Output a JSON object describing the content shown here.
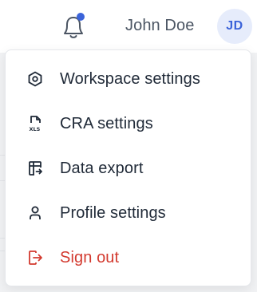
{
  "header": {
    "user_name": "John Doe",
    "avatar_initials": "JD",
    "bell_icon": "bell-icon",
    "notification_color": "#3b63d9"
  },
  "menu": {
    "items": [
      {
        "label": "Workspace settings",
        "icon": "hexagon-settings-icon"
      },
      {
        "label": "CRA settings",
        "icon": "xls-file-icon"
      },
      {
        "label": "Data export",
        "icon": "table-export-icon"
      },
      {
        "label": "Profile settings",
        "icon": "user-icon"
      },
      {
        "label": "Sign out",
        "icon": "logout-icon",
        "color": "#d33a2f"
      }
    ]
  }
}
